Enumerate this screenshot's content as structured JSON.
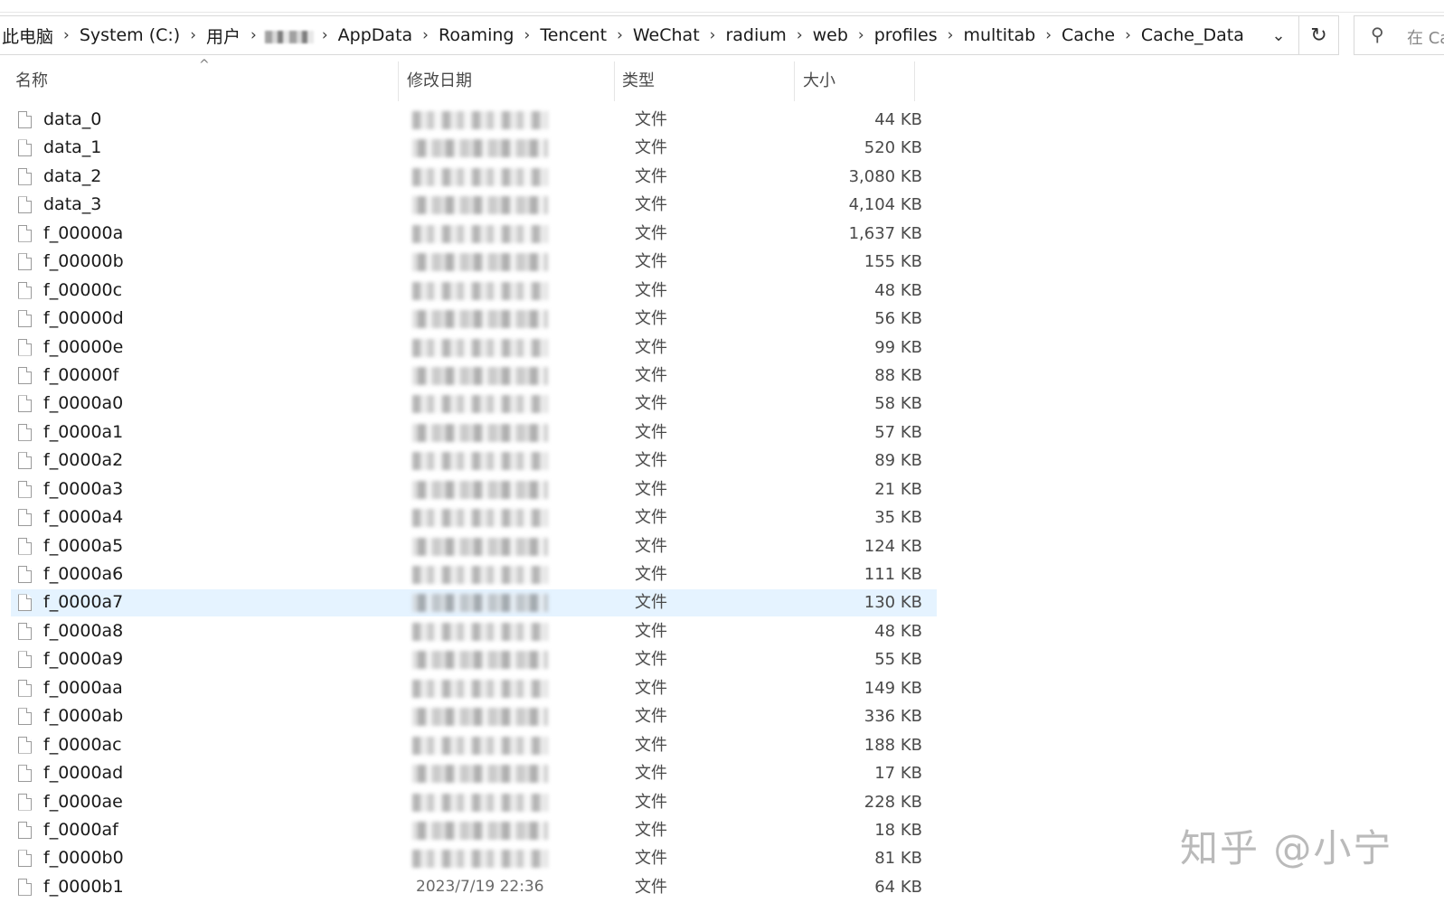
{
  "addressbar": {
    "crumbs": [
      "此电脑",
      "System (C:)",
      "用户",
      "",
      "AppData",
      "Roaming",
      "Tencent",
      "WeChat",
      "radium",
      "web",
      "profiles",
      "multitab",
      "Cache",
      "Cache_Data"
    ]
  },
  "search": {
    "placeholder": "在 Ca"
  },
  "columns": {
    "name": "名称",
    "modified": "修改日期",
    "type": "类型",
    "size": "大小"
  },
  "files": [
    {
      "name": "data_0",
      "type": "文件",
      "size": "44 KB"
    },
    {
      "name": "data_1",
      "type": "文件",
      "size": "520 KB"
    },
    {
      "name": "data_2",
      "type": "文件",
      "size": "3,080 KB"
    },
    {
      "name": "data_3",
      "type": "文件",
      "size": "4,104 KB"
    },
    {
      "name": "f_00000a",
      "type": "文件",
      "size": "1,637 KB"
    },
    {
      "name": "f_00000b",
      "type": "文件",
      "size": "155 KB"
    },
    {
      "name": "f_00000c",
      "type": "文件",
      "size": "48 KB"
    },
    {
      "name": "f_00000d",
      "type": "文件",
      "size": "56 KB"
    },
    {
      "name": "f_00000e",
      "type": "文件",
      "size": "99 KB"
    },
    {
      "name": "f_00000f",
      "type": "文件",
      "size": "88 KB"
    },
    {
      "name": "f_0000a0",
      "type": "文件",
      "size": "58 KB"
    },
    {
      "name": "f_0000a1",
      "type": "文件",
      "size": "57 KB"
    },
    {
      "name": "f_0000a2",
      "type": "文件",
      "size": "89 KB"
    },
    {
      "name": "f_0000a3",
      "type": "文件",
      "size": "21 KB"
    },
    {
      "name": "f_0000a4",
      "type": "文件",
      "size": "35 KB"
    },
    {
      "name": "f_0000a5",
      "type": "文件",
      "size": "124 KB"
    },
    {
      "name": "f_0000a6",
      "type": "文件",
      "size": "111 KB"
    },
    {
      "name": "f_0000a7",
      "type": "文件",
      "size": "130 KB",
      "selected": true
    },
    {
      "name": "f_0000a8",
      "type": "文件",
      "size": "48 KB"
    },
    {
      "name": "f_0000a9",
      "type": "文件",
      "size": "55 KB"
    },
    {
      "name": "f_0000aa",
      "type": "文件",
      "size": "149 KB"
    },
    {
      "name": "f_0000ab",
      "type": "文件",
      "size": "336 KB"
    },
    {
      "name": "f_0000ac",
      "type": "文件",
      "size": "188 KB"
    },
    {
      "name": "f_0000ad",
      "type": "文件",
      "size": "17 KB"
    },
    {
      "name": "f_0000ae",
      "type": "文件",
      "size": "228 KB"
    },
    {
      "name": "f_0000af",
      "type": "文件",
      "size": "18 KB"
    },
    {
      "name": "f_0000b0",
      "type": "文件",
      "size": "81 KB"
    },
    {
      "name": "f_0000b1",
      "type": "文件",
      "size": "64 KB",
      "modified": "2023/7/19 22:36"
    }
  ],
  "watermark": "知乎 @小宁"
}
